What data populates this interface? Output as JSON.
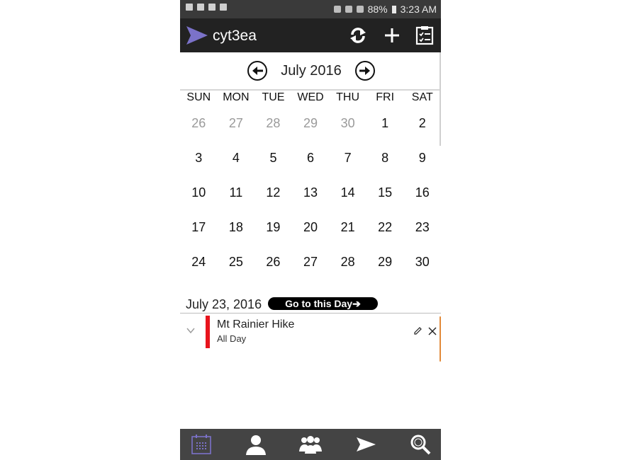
{
  "status_bar": {
    "battery": "88%",
    "time": "3:23 AM"
  },
  "app_bar": {
    "title": "cyt3ea"
  },
  "calendar": {
    "month_label": "July 2016",
    "weekdays": [
      "SUN",
      "MON",
      "TUE",
      "WED",
      "THU",
      "FRI",
      "SAT"
    ],
    "weeks": [
      [
        "26",
        "27",
        "28",
        "29",
        "30",
        "1",
        "2"
      ],
      [
        "3",
        "4",
        "5",
        "6",
        "7",
        "8",
        "9"
      ],
      [
        "10",
        "11",
        "12",
        "13",
        "14",
        "15",
        "16"
      ],
      [
        "17",
        "18",
        "19",
        "20",
        "21",
        "22",
        "23"
      ],
      [
        "24",
        "25",
        "26",
        "27",
        "28",
        "29",
        "30"
      ]
    ]
  },
  "selected_day": {
    "label": "July 23, 2016",
    "goto_label": "Go to this Day➔"
  },
  "event": {
    "title": "Mt Rainier Hike",
    "subtitle": "All Day",
    "color": "#e8141d"
  },
  "colors": {
    "accent": "#7b72c9",
    "appbar": "#222222",
    "bottomnav": "#444444"
  },
  "icons": {
    "app_bar": [
      "send-logo-icon",
      "sync-icon",
      "add-icon",
      "tasks-icon"
    ],
    "bottom_nav": [
      "calendar-icon",
      "person-icon",
      "groups-icon",
      "send-icon",
      "search-icon"
    ]
  }
}
